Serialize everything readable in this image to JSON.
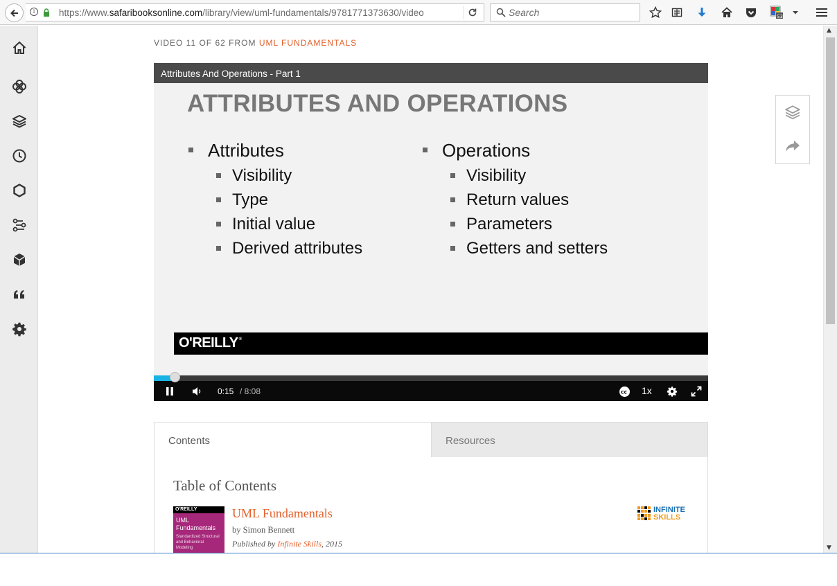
{
  "browser": {
    "url_prefix": "https://www.",
    "url_domain": "safaribooksonline.com",
    "url_path": "/library/view/uml-fundamentals/9781771373630/video",
    "search_placeholder": "Search"
  },
  "header": {
    "video_prefix": "VIDEO 11 OF 62 FROM",
    "course_link": "UML FUNDAMENTALS"
  },
  "player": {
    "title": "Attributes And Operations - Part 1",
    "slide": {
      "heading": "ATTRIBUTES AND OPERATIONS",
      "left_head": "Attributes",
      "left_items": [
        "Visibility",
        "Type",
        "Initial value",
        "Derived attributes"
      ],
      "right_head": "Operations",
      "right_items": [
        "Visibility",
        "Return values",
        "Parameters",
        "Getters and setters"
      ],
      "brand": "O'REILLY"
    },
    "controls": {
      "current_time": "0:15",
      "total_time": "/ 8:08",
      "progress_fraction": 0.031,
      "speed": "1x"
    }
  },
  "tabs": {
    "contents": "Contents",
    "resources": "Resources"
  },
  "toc": {
    "title": "Table of Contents",
    "book_title": "UML Fundamentals",
    "author": "by Simon Bennett",
    "published_prefix": "Published by",
    "publisher": "Infinite Skills",
    "year": ", 2015",
    "cover": {
      "brand": "O'REILLY",
      "title": "UML Fundamentals",
      "subtitle": "Standardized Structural and Behavioral Modeling"
    },
    "publisher_logo": {
      "line1": "INFINITE",
      "line2": "SKILLS"
    }
  },
  "colors": {
    "accent": "#e4602b",
    "progress": "#1ab4e4",
    "player_title_bg": "#4a4a4a"
  },
  "sidebar_icons": [
    "home-icon",
    "topics-icon",
    "layers-icon",
    "history-icon",
    "hexagon-icon",
    "paths-icon",
    "cube-icon",
    "quote-icon",
    "settings-icon"
  ]
}
